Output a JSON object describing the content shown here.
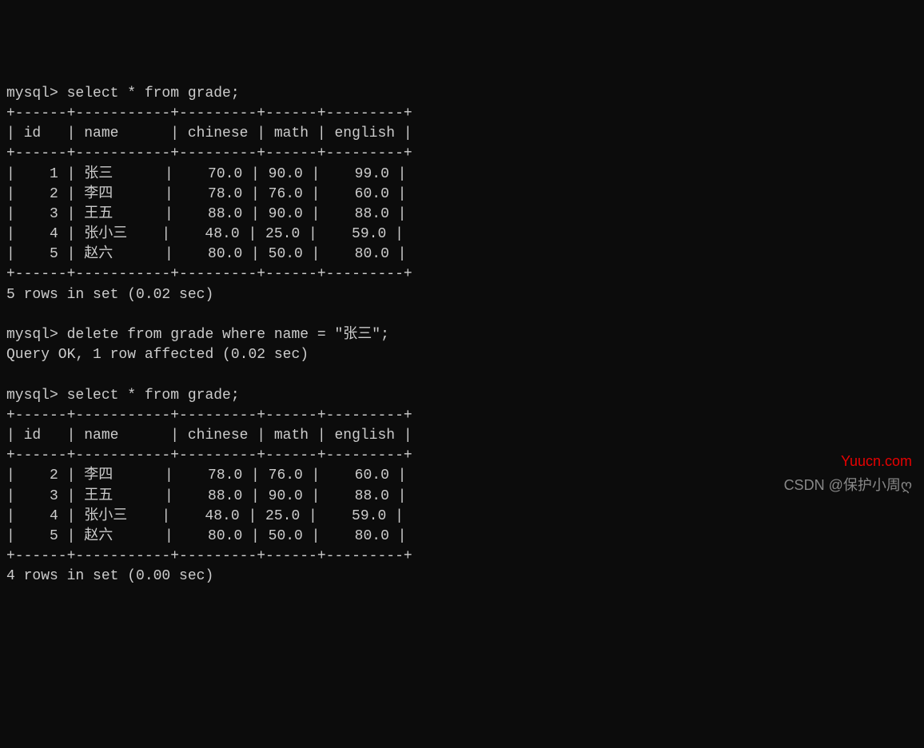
{
  "prompt": "mysql>",
  "query1": {
    "command": "select * from grade;",
    "columns": [
      "id",
      "name",
      "chinese",
      "math",
      "english"
    ],
    "rows": [
      {
        "id": "1",
        "name": "张三",
        "chinese": "70.0",
        "math": "90.0",
        "english": "99.0"
      },
      {
        "id": "2",
        "name": "李四",
        "chinese": "78.0",
        "math": "76.0",
        "english": "60.0"
      },
      {
        "id": "3",
        "name": "王五",
        "chinese": "88.0",
        "math": "90.0",
        "english": "88.0"
      },
      {
        "id": "4",
        "name": "张小三",
        "chinese": "48.0",
        "math": "25.0",
        "english": "59.0"
      },
      {
        "id": "5",
        "name": "赵六",
        "chinese": "80.0",
        "math": "50.0",
        "english": "80.0"
      }
    ],
    "result": "5 rows in set (0.02 sec)"
  },
  "query2": {
    "command": "delete from grade where name = \"张三\";",
    "result": "Query OK, 1 row affected (0.02 sec)"
  },
  "query3": {
    "command": "select * from grade;",
    "columns": [
      "id",
      "name",
      "chinese",
      "math",
      "english"
    ],
    "rows": [
      {
        "id": "2",
        "name": "李四",
        "chinese": "78.0",
        "math": "76.0",
        "english": "60.0"
      },
      {
        "id": "3",
        "name": "王五",
        "chinese": "88.0",
        "math": "90.0",
        "english": "88.0"
      },
      {
        "id": "4",
        "name": "张小三",
        "chinese": "48.0",
        "math": "25.0",
        "english": "59.0"
      },
      {
        "id": "5",
        "name": "赵六",
        "chinese": "80.0",
        "math": "50.0",
        "english": "80.0"
      }
    ],
    "result": "4 rows in set (0.00 sec)"
  },
  "watermarks": {
    "top": "Yuucn.com",
    "bottom": "CSDN @保护小周ღ"
  },
  "table_border": "+------+-----------+---------+------+---------+",
  "col_widths": {
    "id": 6,
    "name": 11,
    "chinese": 9,
    "math": 6,
    "english": 9
  }
}
